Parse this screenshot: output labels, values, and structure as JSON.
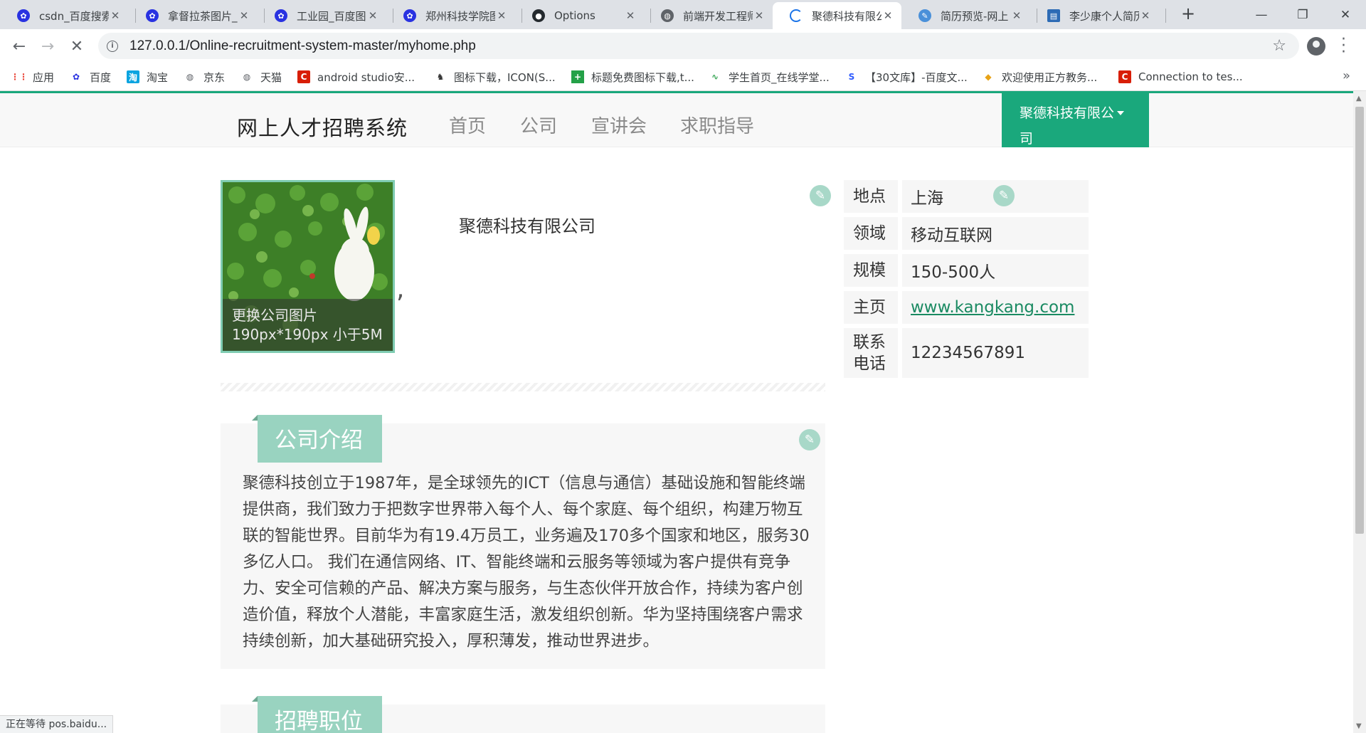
{
  "browser": {
    "tabs": [
      {
        "title": "csdn_百度搜索",
        "icon": "baidu-paw-icon",
        "icon_color": "#2932e1"
      },
      {
        "title": "拿督拉茶图片_",
        "icon": "baidu-paw-icon",
        "icon_color": "#2932e1"
      },
      {
        "title": "工业园_百度图",
        "icon": "baidu-paw-icon",
        "icon_color": "#2932e1"
      },
      {
        "title": "郑州科技学院图",
        "icon": "baidu-paw-icon",
        "icon_color": "#2932e1"
      },
      {
        "title": "Options",
        "icon": "github-icon",
        "icon_color": "#24292e"
      },
      {
        "title": "前端开发工程师",
        "icon": "globe-icon",
        "icon_color": "#5f6368"
      },
      {
        "title": "聚德科技有限公",
        "icon": "loading-icon",
        "icon_color": "#1a73e8"
      },
      {
        "title": "简历预览-网上",
        "icon": "resume-icon",
        "icon_color": "#4a90d9"
      },
      {
        "title": "李少康个人简历",
        "icon": "card-icon",
        "icon_color": "#2d6bb5"
      }
    ],
    "url": "127.0.0.1/Online-recruitment-system-master/myhome.php",
    "bookmarks": [
      {
        "label": "应用",
        "icon": "apps-grid-icon",
        "color": "#e94235"
      },
      {
        "label": "百度",
        "icon": "baidu-paw-icon",
        "color": "#2932e1"
      },
      {
        "label": "淘宝",
        "icon": "taobao-icon",
        "color": "#0aa4e0"
      },
      {
        "label": "京东",
        "icon": "globe-icon",
        "color": "#5f6368"
      },
      {
        "label": "天猫",
        "icon": "globe-icon",
        "color": "#5f6368"
      },
      {
        "label": "android studio安...",
        "icon": "csdn-c-icon",
        "color": "#d81e06"
      },
      {
        "label": "图标下载，ICON(S...",
        "icon": "iconfont-icon",
        "color": "#333333"
      },
      {
        "label": "标题免费图标下载,t...",
        "icon": "plus-tile-icon",
        "color": "#24a148"
      },
      {
        "label": "学生首页_在线学堂...",
        "icon": "wave-icon",
        "color": "#3aa757"
      },
      {
        "label": "【30文库】-百度文...",
        "icon": "wenku-s-icon",
        "color": "#2e5bff"
      },
      {
        "label": "欢迎使用正方教务...",
        "icon": "zhengfang-icon",
        "color": "#e8a317"
      },
      {
        "label": "Connection to tes...",
        "icon": "csdn-c-icon",
        "color": "#d81e06"
      }
    ],
    "status_text": "正在等待 pos.baidu..."
  },
  "site": {
    "brand": "网上人才招聘系统",
    "nav": [
      "首页",
      "公司",
      "宣讲会",
      "求职指导"
    ],
    "user_menu_line1": "聚德科技有限公",
    "user_menu_line2": "司",
    "accent": "#1aa87c"
  },
  "company": {
    "name": "聚德科技有限公司",
    "logo_hint_line1": "更换公司图片",
    "logo_hint_line2": "190px*190px 小于5M",
    "info": [
      {
        "label": "地点",
        "value": "上海"
      },
      {
        "label": "领域",
        "value": "移动互联网"
      },
      {
        "label": "规模",
        "value": "150-500人"
      },
      {
        "label": "主页",
        "value": "www.kangkang.com"
      },
      {
        "label": "联系电话",
        "value": "12234567891"
      }
    ],
    "intro_heading": "公司介绍",
    "intro_text": "聚德科技创立于1987年，是全球领先的ICT（信息与通信）基础设施和智能终端提供商，我们致力于把数字世界带入每个人、每个家庭、每个组织，构建万物互联的智能世界。目前华为有19.4万员工，业务遍及170多个国家和地区，服务30多亿人口。 我们在通信网络、IT、智能终端和云服务等领域为客户提供有竞争力、安全可信赖的产品、解决方案与服务，与生态伙伴开放合作，持续为客户创造价值，释放个人潜能，丰富家庭生活，激发组织创新。华为坚持围绕客户需求持续创新，加大基础研究投入，厚积薄发，推动世界进步。",
    "jobs_heading": "招聘职位"
  }
}
